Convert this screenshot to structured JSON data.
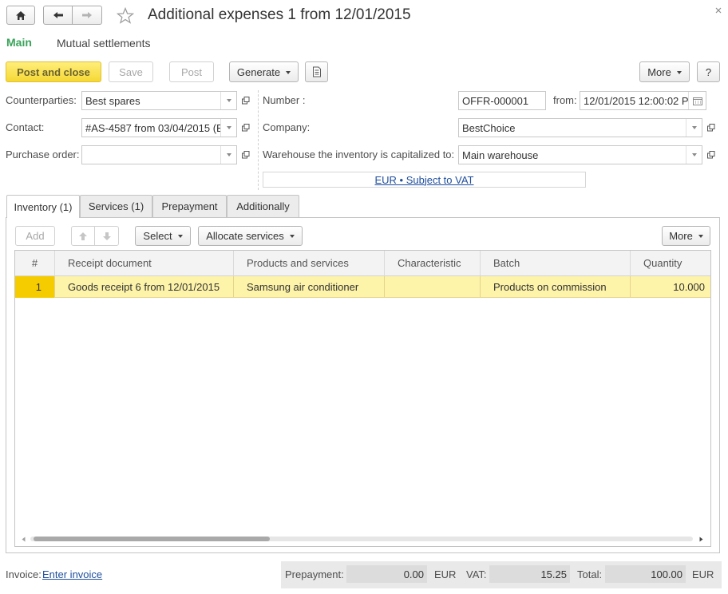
{
  "window": {
    "title": "Additional expenses 1 from 12/01/2015"
  },
  "section_tabs": [
    "Main",
    "Mutual settlements"
  ],
  "toolbar": {
    "post_and_close": "Post and close",
    "save": "Save",
    "post": "Post",
    "generate": "Generate",
    "more": "More",
    "help": "?"
  },
  "form": {
    "counterparties_label": "Counterparties:",
    "counterparties_value": "Best spares",
    "contact_label": "Contact:",
    "contact_value": "#AS-4587 from 03/04/2015 (E",
    "purchase_order_label": "Purchase order:",
    "purchase_order_value": "",
    "number_label": "Number :",
    "number_value": "OFFR-000001",
    "from_label": "from:",
    "from_value": "12/01/2015 12:00:02 P",
    "company_label": "Company:",
    "company_value": "BestChoice",
    "warehouse_label": "Warehouse the inventory is capitalized to:",
    "warehouse_value": "Main warehouse",
    "currency_link": "EUR • Subject to VAT"
  },
  "tabs": [
    {
      "label": "Inventory (1)"
    },
    {
      "label": "Services (1)"
    },
    {
      "label": "Prepayment"
    },
    {
      "label": "Additionally"
    }
  ],
  "table_toolbar": {
    "add": "Add",
    "select": "Select",
    "allocate": "Allocate services",
    "more": "More"
  },
  "table": {
    "columns": [
      "#",
      "Receipt document",
      "Products and services",
      "Characteristic",
      "Batch",
      "Quantity"
    ],
    "rows": [
      {
        "num": "1",
        "receipt_document": "Goods receipt 6 from 12/01/2015",
        "products_services": "Samsung air conditioner",
        "characteristic": "",
        "batch": "Products on commission",
        "quantity": "10.000"
      }
    ]
  },
  "footer": {
    "invoice_label": "Invoice:",
    "invoice_link": "Enter invoice",
    "prepayment_label": "Prepayment:",
    "prepayment_value": "0.00",
    "prepayment_currency": "EUR",
    "vat_label": "VAT:",
    "vat_value": "15.25",
    "total_label": "Total:",
    "total_value": "100.00",
    "total_currency": "EUR"
  },
  "colors": {
    "accent_green": "#3aa35a",
    "primary_button": "#f5d835",
    "selected_row": "#fdf3a9",
    "selected_cell": "#f5cc00",
    "link": "#1f4e9d"
  },
  "icons": [
    "home-icon",
    "back-arrow-icon",
    "forward-arrow-icon",
    "star-icon",
    "close-icon",
    "document-report-icon",
    "calendar-icon",
    "open-in-new-icon",
    "move-up-icon",
    "move-down-icon",
    "scroll-left-icon",
    "scroll-right-icon"
  ]
}
